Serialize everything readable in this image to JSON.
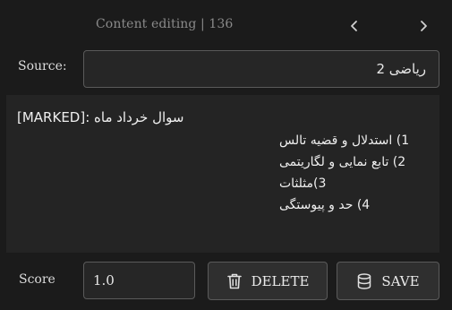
{
  "header": {
    "title": "Content editing | 136",
    "prev_icon": "chevron-left-icon",
    "next_icon": "chevron-right-icon"
  },
  "source": {
    "label": "Source:",
    "value": "ریاضی 2"
  },
  "content": {
    "first_line": "[MARKED]: سوال خرداد ماه",
    "lines": [
      "1) استدلال و قضیه تالس",
      "2) تابع نمایی و لگاریتمی",
      "3)مثلثات",
      "4) حد و پیوستگی"
    ]
  },
  "score": {
    "label": "Score",
    "value": "1.0"
  },
  "buttons": {
    "delete_label": "DELETE",
    "delete_icon": "trash-icon",
    "save_label": "SAVE",
    "save_icon": "database-icon"
  },
  "colors": {
    "background": "#1b1b1b",
    "panel": "#242424",
    "border": "#5a5a5a",
    "muted_text": "#8a8a8a"
  }
}
